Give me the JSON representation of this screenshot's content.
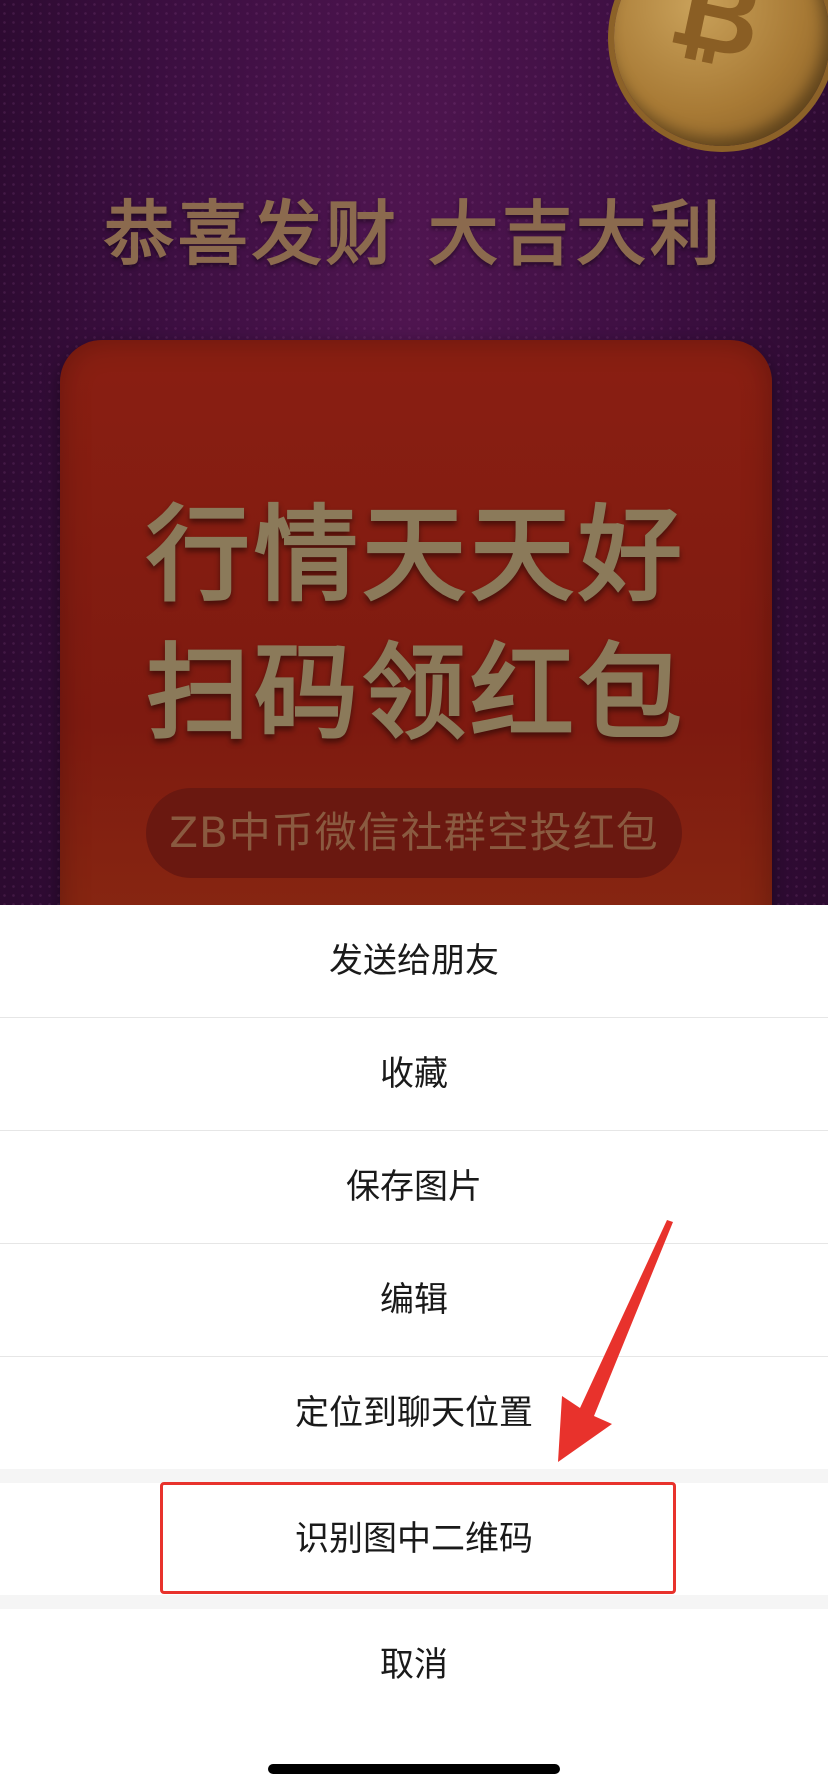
{
  "poster": {
    "headline": "恭喜发财 大吉大利",
    "card_line1": "行情天天好",
    "card_line2": "扫码领红包",
    "pill_text": "ZB中币微信社群空投红包"
  },
  "action_sheet": {
    "items": [
      {
        "label": "发送给朋友"
      },
      {
        "label": "收藏"
      },
      {
        "label": "保存图片"
      },
      {
        "label": "编辑"
      },
      {
        "label": "定位到聊天位置"
      }
    ],
    "qr_label": "识别图中二维码",
    "cancel_label": "取消"
  },
  "colors": {
    "highlight": "#e8322c"
  }
}
